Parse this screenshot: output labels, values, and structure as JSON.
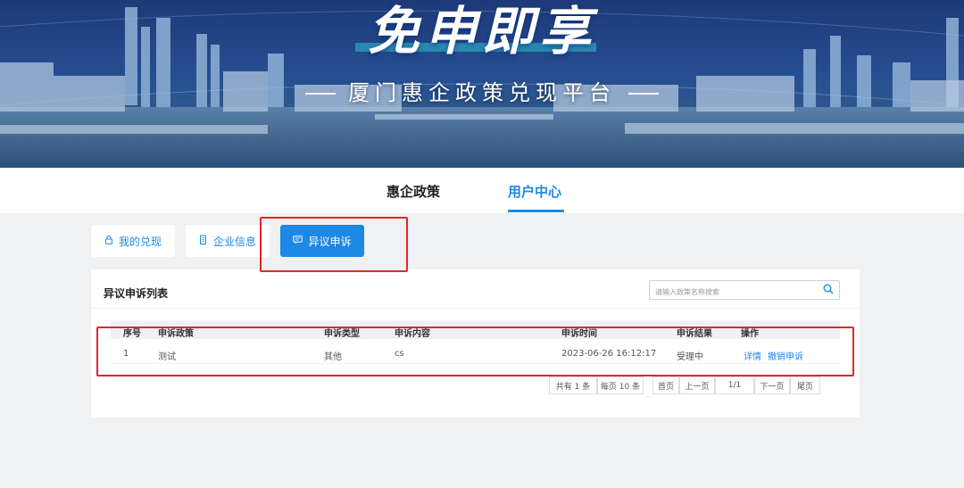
{
  "banner": {
    "title": "免申即享",
    "subtitle": "厦门惠企政策兑现平台"
  },
  "nav": {
    "tabs": [
      {
        "label": "惠企政策"
      },
      {
        "label": "用户中心",
        "active": true
      }
    ]
  },
  "top_buttons": [
    {
      "label": "我的兑现",
      "icon": "lock-icon"
    },
    {
      "label": "企业信息",
      "icon": "building-icon"
    },
    {
      "label": "异议申诉",
      "icon": "chat-icon",
      "active": true
    }
  ],
  "panel": {
    "title": "异议申诉列表",
    "search_placeholder": "请输入政策名称搜索"
  },
  "table": {
    "headers": [
      "序号",
      "申诉政策",
      "申诉类型",
      "申诉内容",
      "申诉时间",
      "申诉结果",
      "操作"
    ],
    "rows": [
      {
        "index": "1",
        "policy": "测试",
        "type": "其他",
        "content": "cs",
        "time": "2023-06-26 16:12:17",
        "result": "受理中",
        "actions": [
          "详情",
          "撤销申诉"
        ]
      }
    ]
  },
  "pagination": {
    "total": "共有 1 条",
    "per_page": "每页 10 条",
    "first": "首页",
    "prev": "上一页",
    "current": "1/1",
    "next": "下一页",
    "last": "尾页"
  },
  "colors": {
    "accent": "#1e88e5",
    "highlight": "#e5242b"
  }
}
